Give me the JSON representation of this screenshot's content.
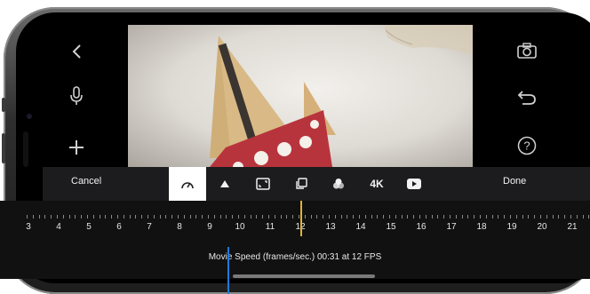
{
  "toolbar": {
    "cancel_label": "Cancel",
    "done_label": "Done",
    "resolution_label": "4K",
    "tools": [
      "speed-icon",
      "triangle-icon",
      "aspect-ratio-icon",
      "layers-icon",
      "color-filter-icon",
      "4k-badge",
      "youtube-icon"
    ],
    "active_tool": "speed-icon"
  },
  "left_controls": [
    "back-chevron-icon",
    "microphone-icon",
    "plus-icon"
  ],
  "right_controls": [
    "camera-icon",
    "undo-icon",
    "help-icon"
  ],
  "ruler": {
    "labels": [
      "3",
      "4",
      "5",
      "6",
      "7",
      "8",
      "9",
      "10",
      "11",
      "12",
      "13",
      "14",
      "15",
      "16",
      "17",
      "18",
      "19",
      "20",
      "21"
    ],
    "selected_value": 12
  },
  "status": {
    "text": "Movie Speed (frames/sec.) 00:31 at 12 FPS"
  },
  "colors": {
    "accent_blue": "#1e7bd8",
    "accent_yellow": "#e1b23b",
    "toolbar_bg": "#1c1c1e",
    "sail_color": "#d9b985",
    "hull_color": "#b8343c"
  }
}
